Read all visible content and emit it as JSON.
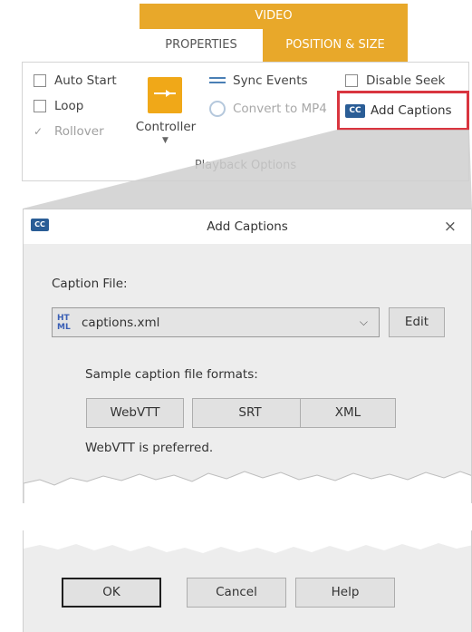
{
  "ribbon": {
    "tab_group": "VIDEO",
    "tabs": [
      {
        "label": "PROPERTIES"
      },
      {
        "label": "POSITION & SIZE"
      }
    ],
    "checks": {
      "auto_start": "Auto Start",
      "loop": "Loop",
      "rollover": "Rollover",
      "disable_seek": "Disable Seek"
    },
    "controller_label": "Controller",
    "sync_events": "Sync Events",
    "convert_mp4": "Convert to MP4",
    "add_captions": "Add Captions",
    "cc_glyph": "CC",
    "group_label": "Playback Options",
    "colors": {
      "tab_accent": "#e8a82a",
      "highlight": "#d9353f",
      "cc_badge": "#2a5d96"
    }
  },
  "dialog": {
    "title": "Add Captions",
    "close": "×",
    "caption_file_label": "Caption File:",
    "selected_file": "captions.xml",
    "file_icon_top": "HT",
    "file_icon_bottom": "ML",
    "edit_label": "Edit",
    "formats_label": "Sample caption file formats:",
    "formats": [
      "WebVTT",
      "SRT",
      "XML"
    ],
    "note": "WebVTT is preferred.",
    "ok_label": "OK",
    "cancel_label": "Cancel",
    "help_label": "Help"
  }
}
